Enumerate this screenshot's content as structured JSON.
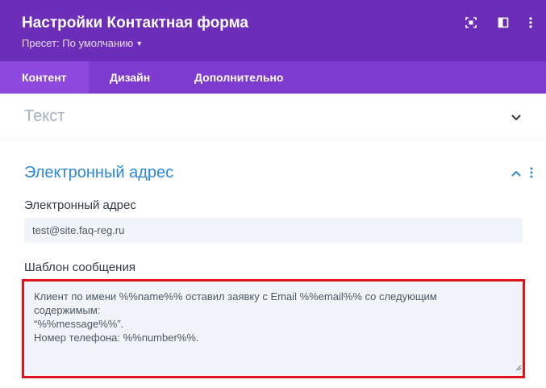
{
  "header": {
    "title": "Настройки Контактная форма",
    "preset_label": "Пресет: По умолчанию",
    "icons": [
      "fullscreen-icon",
      "split-view-icon",
      "more-vertical-icon"
    ]
  },
  "tabs": [
    {
      "label": "Контент",
      "active": true
    },
    {
      "label": "Дизайн",
      "active": false
    },
    {
      "label": "Дополнительно",
      "active": false
    }
  ],
  "sections": {
    "text": {
      "title": "Текст",
      "expanded": false
    },
    "email": {
      "title": "Электронный адрес",
      "expanded": true,
      "email_field": {
        "label": "Электронный адрес",
        "value": "test@site.faq-reg.ru"
      },
      "message_template": {
        "label": "Шаблон сообщения",
        "value": "Клиент по имени %%name%% оставил заявку с Email %%email%% со следующим\nсодержимым:\n“%%message%%”.\nНомер телефона: %%number%%."
      }
    }
  },
  "colors": {
    "header_bg": "#6c2eb9",
    "tabs_bg": "#7e3bd0",
    "active_tab_bg": "#8d48dd",
    "section_active_title": "#2b87da",
    "highlight_border": "#e0151c"
  }
}
